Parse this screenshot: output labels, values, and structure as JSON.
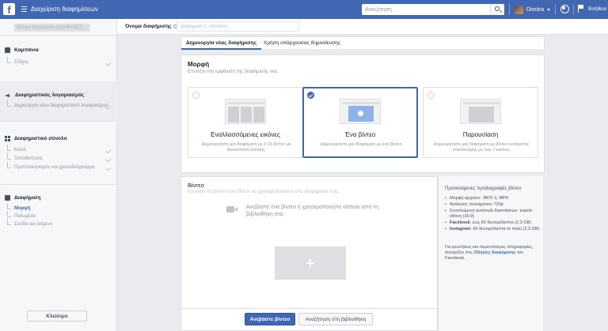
{
  "topbar": {
    "logo": "f",
    "title": "Διαχείριση διαφημίσεων",
    "search_placeholder": "Αναζήτηση",
    "user_name": "Dimitra",
    "help_label": "Βοήθεια"
  },
  "sidebar": {
    "campaign_name": "Όνομα Καμπάνιας (ΔΙΑΦΑΝΕΣ)",
    "sections": [
      {
        "title": "Καμπάνια",
        "items": [
          {
            "label": "Στόχος"
          }
        ]
      },
      {
        "title": "Διαφημιστικός λογαριασμός",
        "items": [
          {
            "label": "Δημιουργία νέου διαφημιστικού λογαριασμού"
          }
        ]
      },
      {
        "title": "Διαφημιστικό σύνολο",
        "items": [
          {
            "label": "Κοινό"
          },
          {
            "label": "Τοποθετήσεις"
          },
          {
            "label": "Προϋπολογισμός και χρονοδιάγραμμα"
          }
        ]
      },
      {
        "title": "Διαφήμιση",
        "items": [
          {
            "label": "Μορφή"
          },
          {
            "label": "Πολυμέσα"
          },
          {
            "label": "Σελίδα και κείμενο"
          }
        ]
      }
    ],
    "close_label": "Κλείσιμο"
  },
  "ad_name": {
    "label": "Όνομα διαφήμισης",
    "value": "Διαφήμιση 1 ΠΙΝΑΚΑΣ"
  },
  "tabs": [
    {
      "label": "Δημιουργία νέας διαφήμισης",
      "active": true
    },
    {
      "label": "Χρήση υπάρχουσας δημοσίευσης",
      "active": false
    }
  ],
  "format": {
    "title": "Μορφή",
    "subtitle": "Επιλέξτε την εμφάνιση της διαφήμισής σας.",
    "options": [
      {
        "title": "Εναλλασσόμενες εικόνες",
        "desc": "Δημιουργήστε μια διαφήμιση με 2-10 βίντεο με δυνατότητα κύλισης",
        "selected": false
      },
      {
        "title": "Ένα βίντεο",
        "desc": "Δημιουργήστε μια διαφήμιση με ένα βίντεο",
        "selected": true
      },
      {
        "title": "Παρουσίαση",
        "desc": "Δημιουργήστε μια διαφήμιση με βίντεο αυτόματης επανάληψης με έως 7 εικόνες",
        "selected": false
      }
    ]
  },
  "video": {
    "title": "Βίντεο",
    "subtitle": "Επιλέξτε τα βίντεο που θέλετε να χρησιμοποιήσετε στις διαφημίσεις σας.",
    "upload_hint": "Ανεβάστε ένα βίντεο ή χρησιμοποιήστε κάποιο από τη βιβλιοθήκη σας",
    "upload_button": "Ανεβάστε βίντεο",
    "library_button": "Αναζήτηση στη βιβλιοθήκη"
  },
  "specs": {
    "title": "Προτεινόμενες προδιαγραφές βίντεο",
    "items": [
      {
        "text": "Μορφή αρχείου: .MOV ή .MP4"
      },
      {
        "text": "Ανάλυση: τουλάχιστον 720p"
      },
      {
        "text": "Συνιστώμενη αναλογία διαστάσεων: ευρεία οθόνη (16:9)"
      },
      {
        "label": "Facebook",
        "text": ": έως 60 δευτερόλεπτα (2,3 GB)"
      },
      {
        "label": "Instagram",
        "text": ": 60 δευτερόλεπτα το πολύ (2,3 GB)"
      }
    ],
    "note_before": "Για ερωτήσεις και περισσότερες πληροφορίες, ανατρέξτε στις ",
    "note_link": "Οδηγίες διαφήμισης",
    "note_after": " του Facebook."
  },
  "colors": {
    "brand": "#4267b2",
    "background": "#e9ebee"
  }
}
